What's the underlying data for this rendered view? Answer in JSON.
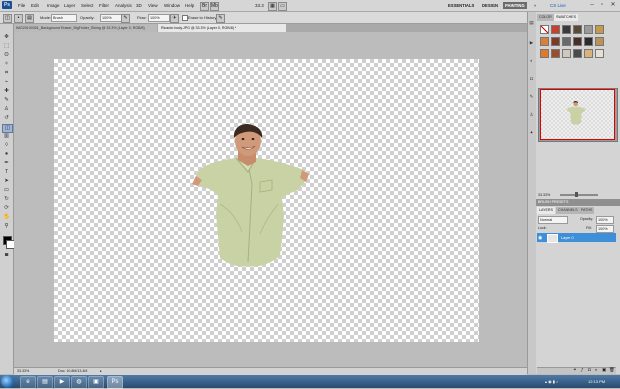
{
  "menubar": {
    "logo": "Ps",
    "items": [
      "File",
      "Edit",
      "Image",
      "Layer",
      "Select",
      "Filter",
      "Analysis",
      "3D",
      "View",
      "Window",
      "Help"
    ],
    "zoom": "33.3",
    "workspaces": [
      "ESSENTIALS",
      "DESIGN",
      "PAINTING"
    ],
    "active_workspace": "PAINTING",
    "cslive": "CS Live"
  },
  "options": {
    "mode_label": "Mode:",
    "mode_value": "Brush",
    "opacity_label": "Opacity:",
    "opacity_value": "100%",
    "flow_label": "Flow:",
    "flow_value": "100%",
    "erase_history": "Erase to History"
  },
  "tabs": [
    {
      "label": "IMG20100301_Background Eraser_BigFolder_Skiing @ 33.3% (Layer 0, RGB/8)",
      "active": false
    },
    {
      "label": "Ricardo body.JPG @ 33.3% (Layer 0, RGB/8) *",
      "active": true
    }
  ],
  "status": {
    "zoom": "33.33%",
    "doc": "Doc: 10.8M/13.4M"
  },
  "panels": {
    "color_tabs": [
      "COLOR",
      "SWATCHES"
    ],
    "navigator_zoom": "33.33%",
    "brush_presets": "BRUSH PRESETS",
    "layers_tabs": [
      "LAYERS",
      "CHANNELS",
      "PATHS"
    ],
    "blend_mode": "Normal",
    "opacity_label": "Opacity:",
    "opacity_value": "100%",
    "lock_label": "Lock:",
    "fill_label": "Fill:",
    "fill_value": "100%",
    "layer_name": "Layer 0"
  },
  "taskbar": {
    "time": "12:13 PM"
  },
  "colors": {
    "layer_selected": "#3f8fd8",
    "shirt": "#c9d2a4",
    "skin": "#d09a7a"
  }
}
